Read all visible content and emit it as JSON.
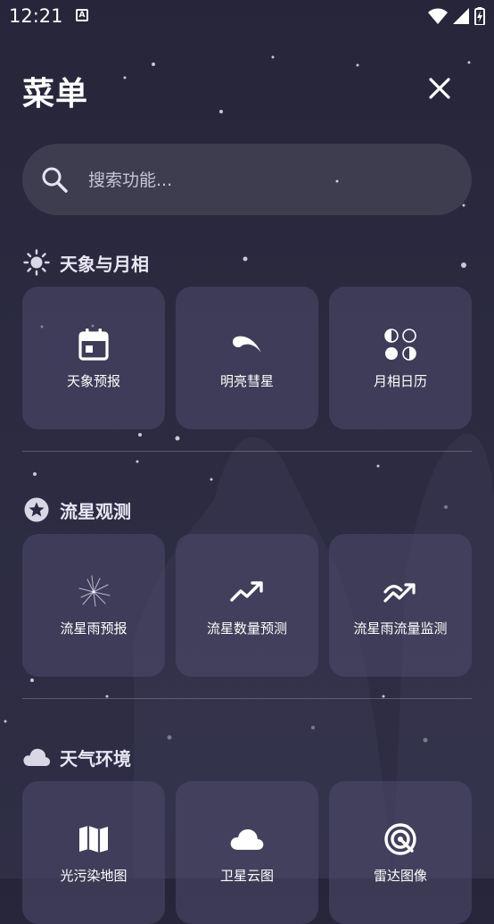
{
  "status_bar": {
    "time": "12:21",
    "notification_icon": "a-icon",
    "icons": [
      "wifi-icon",
      "signal-icon",
      "battery-charging-icon"
    ]
  },
  "header": {
    "title": "菜单",
    "close_icon": "close-icon"
  },
  "search": {
    "placeholder": "搜索功能...",
    "value": "",
    "icon": "search-icon"
  },
  "sections": [
    {
      "title": "天象与月相",
      "icon": "sun-icon",
      "items": [
        {
          "label": "天象预报",
          "icon": "calendar-icon"
        },
        {
          "label": "明亮彗星",
          "icon": "comet-icon"
        },
        {
          "label": "月相日历",
          "icon": "moon-phases-icon"
        }
      ]
    },
    {
      "title": "流星观测",
      "icon": "star-badge-icon",
      "items": [
        {
          "label": "流星雨预报",
          "icon": "meteor-radiant-icon"
        },
        {
          "label": "流星数量预测",
          "icon": "trending-up-icon"
        },
        {
          "label": "流星雨流量监测",
          "icon": "monitor-wave-icon"
        }
      ]
    },
    {
      "title": "天气环境",
      "icon": "cloud-icon",
      "items": [
        {
          "label": "光污染地图",
          "icon": "map-icon"
        },
        {
          "label": "卫星云图",
          "icon": "cloud-icon"
        },
        {
          "label": "雷达图像",
          "icon": "radar-icon"
        }
      ]
    }
  ],
  "colors": {
    "background": "#2a293f",
    "card": "#4a4768",
    "text": "#ffffff"
  }
}
